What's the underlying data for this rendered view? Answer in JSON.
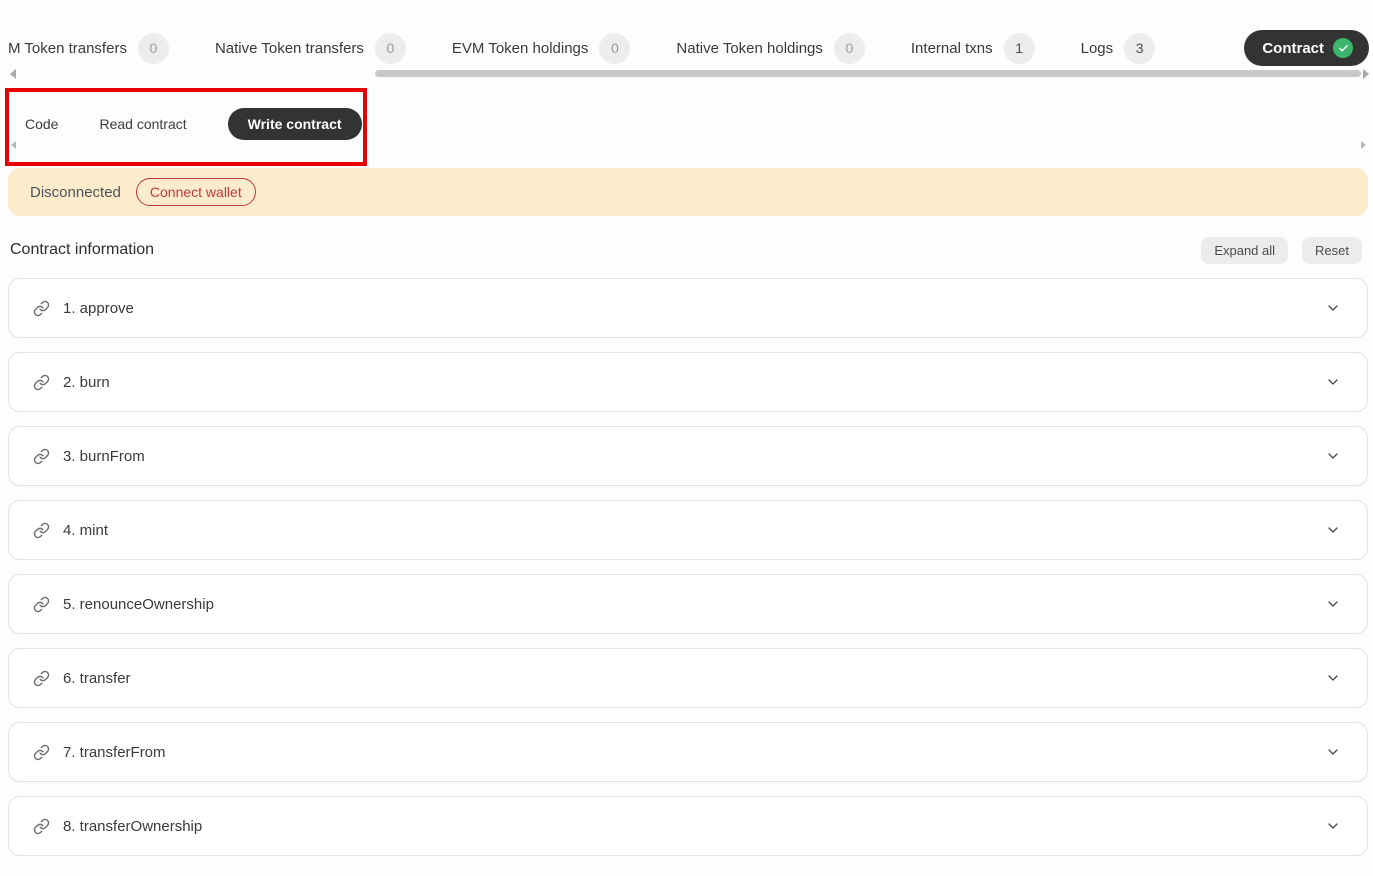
{
  "colors": {
    "accent-dark": "#333333",
    "page-bg": "#fdfdfd",
    "card-border": "#e3e3e3",
    "badge-bg": "#ededed",
    "badge-muted-text": "#9a9a9a",
    "badge-strong-text": "#4c4c4c",
    "banner-bg": "#fdeccc",
    "banner-text": "#50505c",
    "connect-red": "#c03a3c",
    "annotation-red": "#e80000",
    "check-green": "#3cb66d",
    "text-primary": "#3a3a3a",
    "icon-gray": "#6e6e6e",
    "scrollbar-thumb": "#c9c9c9",
    "ghost-btn-bg": "#ececec"
  },
  "icons": {
    "function-link": "chain-link",
    "row-expand": "chevron-down",
    "contract-verified": "check-circle",
    "scroll-left": "triangle-left",
    "scroll-right": "triangle-right"
  },
  "tabs": {
    "items": [
      {
        "label": "M Token transfers",
        "count": "0"
      },
      {
        "label": "Native Token transfers",
        "count": "0"
      },
      {
        "label": "EVM Token holdings",
        "count": "0"
      },
      {
        "label": "Native Token holdings",
        "count": "0"
      },
      {
        "label": "Internal txns",
        "count": "1"
      },
      {
        "label": "Logs",
        "count": "3"
      },
      {
        "label": "Contract"
      }
    ]
  },
  "subtabs": {
    "code": "Code",
    "read": "Read contract",
    "write": "Write contract"
  },
  "banner": {
    "status": "Disconnected",
    "button": "Connect wallet"
  },
  "section": {
    "title": "Contract information",
    "expand_all_label": "Expand all",
    "reset_label": "Reset"
  },
  "functions": [
    {
      "label": "1. approve"
    },
    {
      "label": "2. burn"
    },
    {
      "label": "3. burnFrom"
    },
    {
      "label": "4. mint"
    },
    {
      "label": "5. renounceOwnership"
    },
    {
      "label": "6. transfer"
    },
    {
      "label": "7. transferFrom"
    },
    {
      "label": "8. transferOwnership"
    }
  ]
}
